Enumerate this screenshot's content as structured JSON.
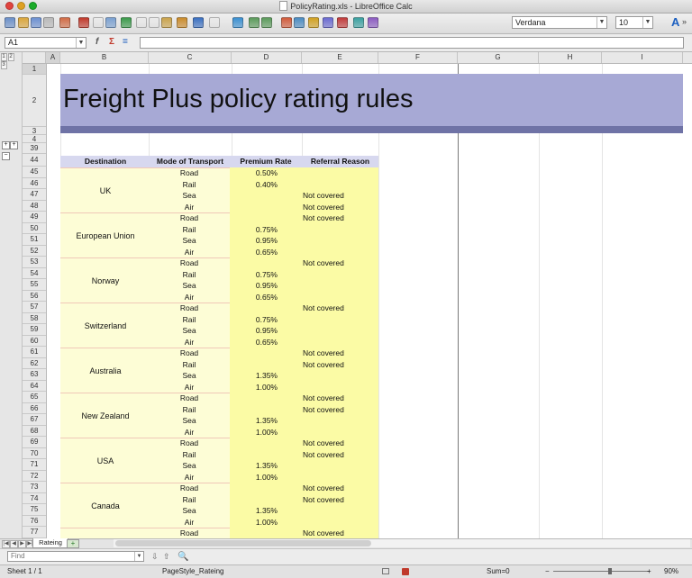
{
  "window": {
    "title": "PolicyRating.xls - LibreOffice Calc"
  },
  "toolbar": {
    "font_name": "Verdana",
    "font_size": "10",
    "icons": [
      "new-icon",
      "open-icon",
      "save-icon",
      "email-icon",
      "edit-icon",
      "pdf-icon",
      "print-icon",
      "preview-icon",
      "spellcheck-icon",
      "cut-icon",
      "copy-icon",
      "paste-icon",
      "format-paintbrush-icon",
      "undo-icon",
      "redo-icon",
      "hyperlink-icon",
      "sort-asc-icon",
      "sort-desc-icon",
      "chart-icon",
      "pivot-icon",
      "draw-icon",
      "find-icon",
      "navigator-icon",
      "gallery-icon",
      "styles-icon",
      "font-color-icon"
    ],
    "font_color_glyph": "A",
    "more_glyph": "»"
  },
  "formula_bar": {
    "cell_ref": "A1",
    "fx_glyph": "f",
    "sum_glyph": "Σ",
    "equals_glyph": "=",
    "content": ""
  },
  "outline": {
    "levels": [
      "1",
      "2",
      "3"
    ],
    "expand": "+",
    "collapse": "−"
  },
  "columns": [
    "A",
    "B",
    "C",
    "D",
    "E",
    "F",
    "G",
    "H",
    "I"
  ],
  "rows": [
    "1",
    "2",
    "3",
    "4",
    "39",
    "44",
    "45",
    "46",
    "47",
    "48",
    "49",
    "50",
    "51",
    "52",
    "53",
    "54",
    "55",
    "56",
    "57",
    "58",
    "59",
    "60",
    "61",
    "62",
    "63",
    "64",
    "65",
    "66",
    "67",
    "68",
    "69",
    "70",
    "71",
    "72",
    "73",
    "74",
    "75",
    "76",
    "77"
  ],
  "sheet": {
    "title": "Freight Plus policy rating rules",
    "headers": [
      "Destination",
      "Mode of Transport",
      "Premium Rate",
      "Referral Reason"
    ],
    "destinations": [
      {
        "name": "UK",
        "rows": [
          {
            "mode": "Road",
            "rate": "0.50%",
            "reason": ""
          },
          {
            "mode": "Rail",
            "rate": "0.40%",
            "reason": ""
          },
          {
            "mode": "Sea",
            "rate": "",
            "reason": "Not covered"
          },
          {
            "mode": "Air",
            "rate": "",
            "reason": "Not covered"
          }
        ]
      },
      {
        "name": "European Union",
        "rows": [
          {
            "mode": "Road",
            "rate": "",
            "reason": "Not covered"
          },
          {
            "mode": "Rail",
            "rate": "0.75%",
            "reason": ""
          },
          {
            "mode": "Sea",
            "rate": "0.95%",
            "reason": ""
          },
          {
            "mode": "Air",
            "rate": "0.65%",
            "reason": ""
          }
        ]
      },
      {
        "name": "Norway",
        "rows": [
          {
            "mode": "Road",
            "rate": "",
            "reason": "Not covered"
          },
          {
            "mode": "Rail",
            "rate": "0.75%",
            "reason": ""
          },
          {
            "mode": "Sea",
            "rate": "0.95%",
            "reason": ""
          },
          {
            "mode": "Air",
            "rate": "0.65%",
            "reason": ""
          }
        ]
      },
      {
        "name": "Switzerland",
        "rows": [
          {
            "mode": "Road",
            "rate": "",
            "reason": "Not covered"
          },
          {
            "mode": "Rail",
            "rate": "0.75%",
            "reason": ""
          },
          {
            "mode": "Sea",
            "rate": "0.95%",
            "reason": ""
          },
          {
            "mode": "Air",
            "rate": "0.65%",
            "reason": ""
          }
        ]
      },
      {
        "name": "Australia",
        "rows": [
          {
            "mode": "Road",
            "rate": "",
            "reason": "Not covered"
          },
          {
            "mode": "Rail",
            "rate": "",
            "reason": "Not covered"
          },
          {
            "mode": "Sea",
            "rate": "1.35%",
            "reason": ""
          },
          {
            "mode": "Air",
            "rate": "1.00%",
            "reason": ""
          }
        ]
      },
      {
        "name": "New Zealand",
        "rows": [
          {
            "mode": "Road",
            "rate": "",
            "reason": "Not covered"
          },
          {
            "mode": "Rail",
            "rate": "",
            "reason": "Not covered"
          },
          {
            "mode": "Sea",
            "rate": "1.35%",
            "reason": ""
          },
          {
            "mode": "Air",
            "rate": "1.00%",
            "reason": ""
          }
        ]
      },
      {
        "name": "USA",
        "rows": [
          {
            "mode": "Road",
            "rate": "",
            "reason": "Not covered"
          },
          {
            "mode": "Rail",
            "rate": "",
            "reason": "Not covered"
          },
          {
            "mode": "Sea",
            "rate": "1.35%",
            "reason": ""
          },
          {
            "mode": "Air",
            "rate": "1.00%",
            "reason": ""
          }
        ]
      },
      {
        "name": "Canada",
        "rows": [
          {
            "mode": "Road",
            "rate": "",
            "reason": "Not covered"
          },
          {
            "mode": "Rail",
            "rate": "",
            "reason": "Not covered"
          },
          {
            "mode": "Sea",
            "rate": "1.35%",
            "reason": ""
          },
          {
            "mode": "Air",
            "rate": "1.00%",
            "reason": ""
          }
        ]
      },
      {
        "name": "",
        "rows": [
          {
            "mode": "Road",
            "rate": "",
            "reason": "Not covered"
          }
        ]
      }
    ]
  },
  "tabs": {
    "nav": [
      "|◀",
      "◀",
      "▶",
      "▶|"
    ],
    "sheets": [
      "Rateing"
    ],
    "add": "+"
  },
  "find": {
    "placeholder": "Find",
    "down": "⇩",
    "up": "⇧",
    "search_glyph": "🔍"
  },
  "status": {
    "sheet": "Sheet 1 / 1",
    "page_style": "PageStyle_Rateing",
    "sum": "Sum=0",
    "zoom_minus": "−",
    "zoom_plus": "+",
    "zoom": "90%"
  },
  "colors": {
    "banner": "#a7a9d5",
    "banner_stripe": "#6f73a6",
    "table_header": "#d7d8ef",
    "pale_yellow": "#fdfdd6",
    "yellow": "#fbfba5"
  }
}
